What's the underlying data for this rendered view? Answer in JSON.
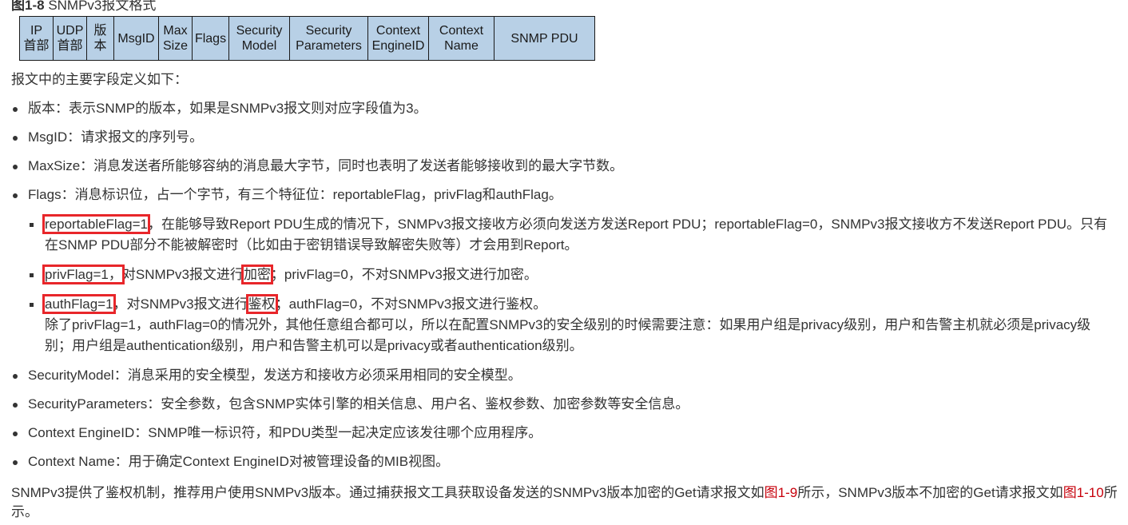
{
  "figure": {
    "label": "图1-8",
    "caption": "SNMPv3报文格式",
    "fields": [
      {
        "line1": "IP",
        "line2": "首部"
      },
      {
        "line1": "UDP",
        "line2": "首部"
      },
      {
        "line1": "版",
        "line2": "本"
      },
      {
        "line1": "MsgID",
        "line2": ""
      },
      {
        "line1": "Max",
        "line2": "Size"
      },
      {
        "line1": "Flags",
        "line2": ""
      },
      {
        "line1": "Security",
        "line2": "Model"
      },
      {
        "line1": "Security",
        "line2": "Parameters"
      },
      {
        "line1": "Context",
        "line2": "EngineID"
      },
      {
        "line1": "Context",
        "line2": "Name"
      },
      {
        "line1": "SNMP PDU",
        "line2": ""
      }
    ]
  },
  "intro": "报文中的主要字段定义如下：",
  "items": {
    "version": "版本：表示SNMP的版本，如果是SNMPv3报文则对应字段值为3。",
    "msgid": "MsgID：请求报文的序列号。",
    "maxsize": "MaxSize：消息发送者所能够容纳的消息最大字节，同时也表明了发送者能够接收到的最大字节数。",
    "flags": "Flags：消息标识位，占一个字节，有三个特征位：reportableFlag，privFlag和authFlag。",
    "sub": {
      "reportable_hl": "reportableFlag=1",
      "reportable_sep": "，",
      "reportable_rest": "在能够导致Report PDU生成的情况下，SNMPv3报文接收方必须向发送方发送Report PDU；reportableFlag=0，SNMPv3报文接收方不发送Report PDU。只有在SNMP PDU部分不能被解密时（比如由于密钥错误导致解密失败等）才会用到Report。",
      "priv_hl": "privFlag=1，",
      "priv_mid": "对SNMPv3报文进行",
      "priv_hl2": "加密",
      "priv_rest": "；privFlag=0，不对SNMPv3报文进行加密。",
      "auth_hl": "authFlag=1",
      "auth_mid": "，对SNMPv3报文进行",
      "auth_hl2": "鉴权",
      "auth_rest": "；authFlag=0，不对SNMPv3报文进行鉴权。",
      "auth_note": "除了privFlag=1，authFlag=0的情况外，其他任意组合都可以，所以在配置SNMPv3的安全级别的时候需要注意：如果用户组是privacy级别，用户和告警主机就必须是privacy级别；用户组是authentication级别，用户和告警主机可以是privacy或者authentication级别。"
    },
    "security_model": "SecurityModel：消息采用的安全模型，发送方和接收方必须采用相同的安全模型。",
    "security_params": "SecurityParameters：安全参数，包含SNMP实体引擎的相关信息、用户名、鉴权参数、加密参数等安全信息。",
    "context_engineid": "Context EngineID：SNMP唯一标识符，和PDU类型一起决定应该发往哪个应用程序。",
    "context_name": "Context Name：用于确定Context EngineID对被管理设备的MIB视图。"
  },
  "outro": {
    "part1": "SNMPv3提供了鉴权机制，推荐用户使用SNMPv3版本。通过捕获报文工具获取设备发送的SNMPv3版本加密的Get请求报文如",
    "link1": "图1-9",
    "part2": "所示，SNMPv3版本不加密的Get请求报文如",
    "link2": "图1-10",
    "part3": "所示。"
  },
  "colors": {
    "field_fill": "#b8d0e6",
    "highlight_box": "#e8262a",
    "link": "#c7000b"
  }
}
